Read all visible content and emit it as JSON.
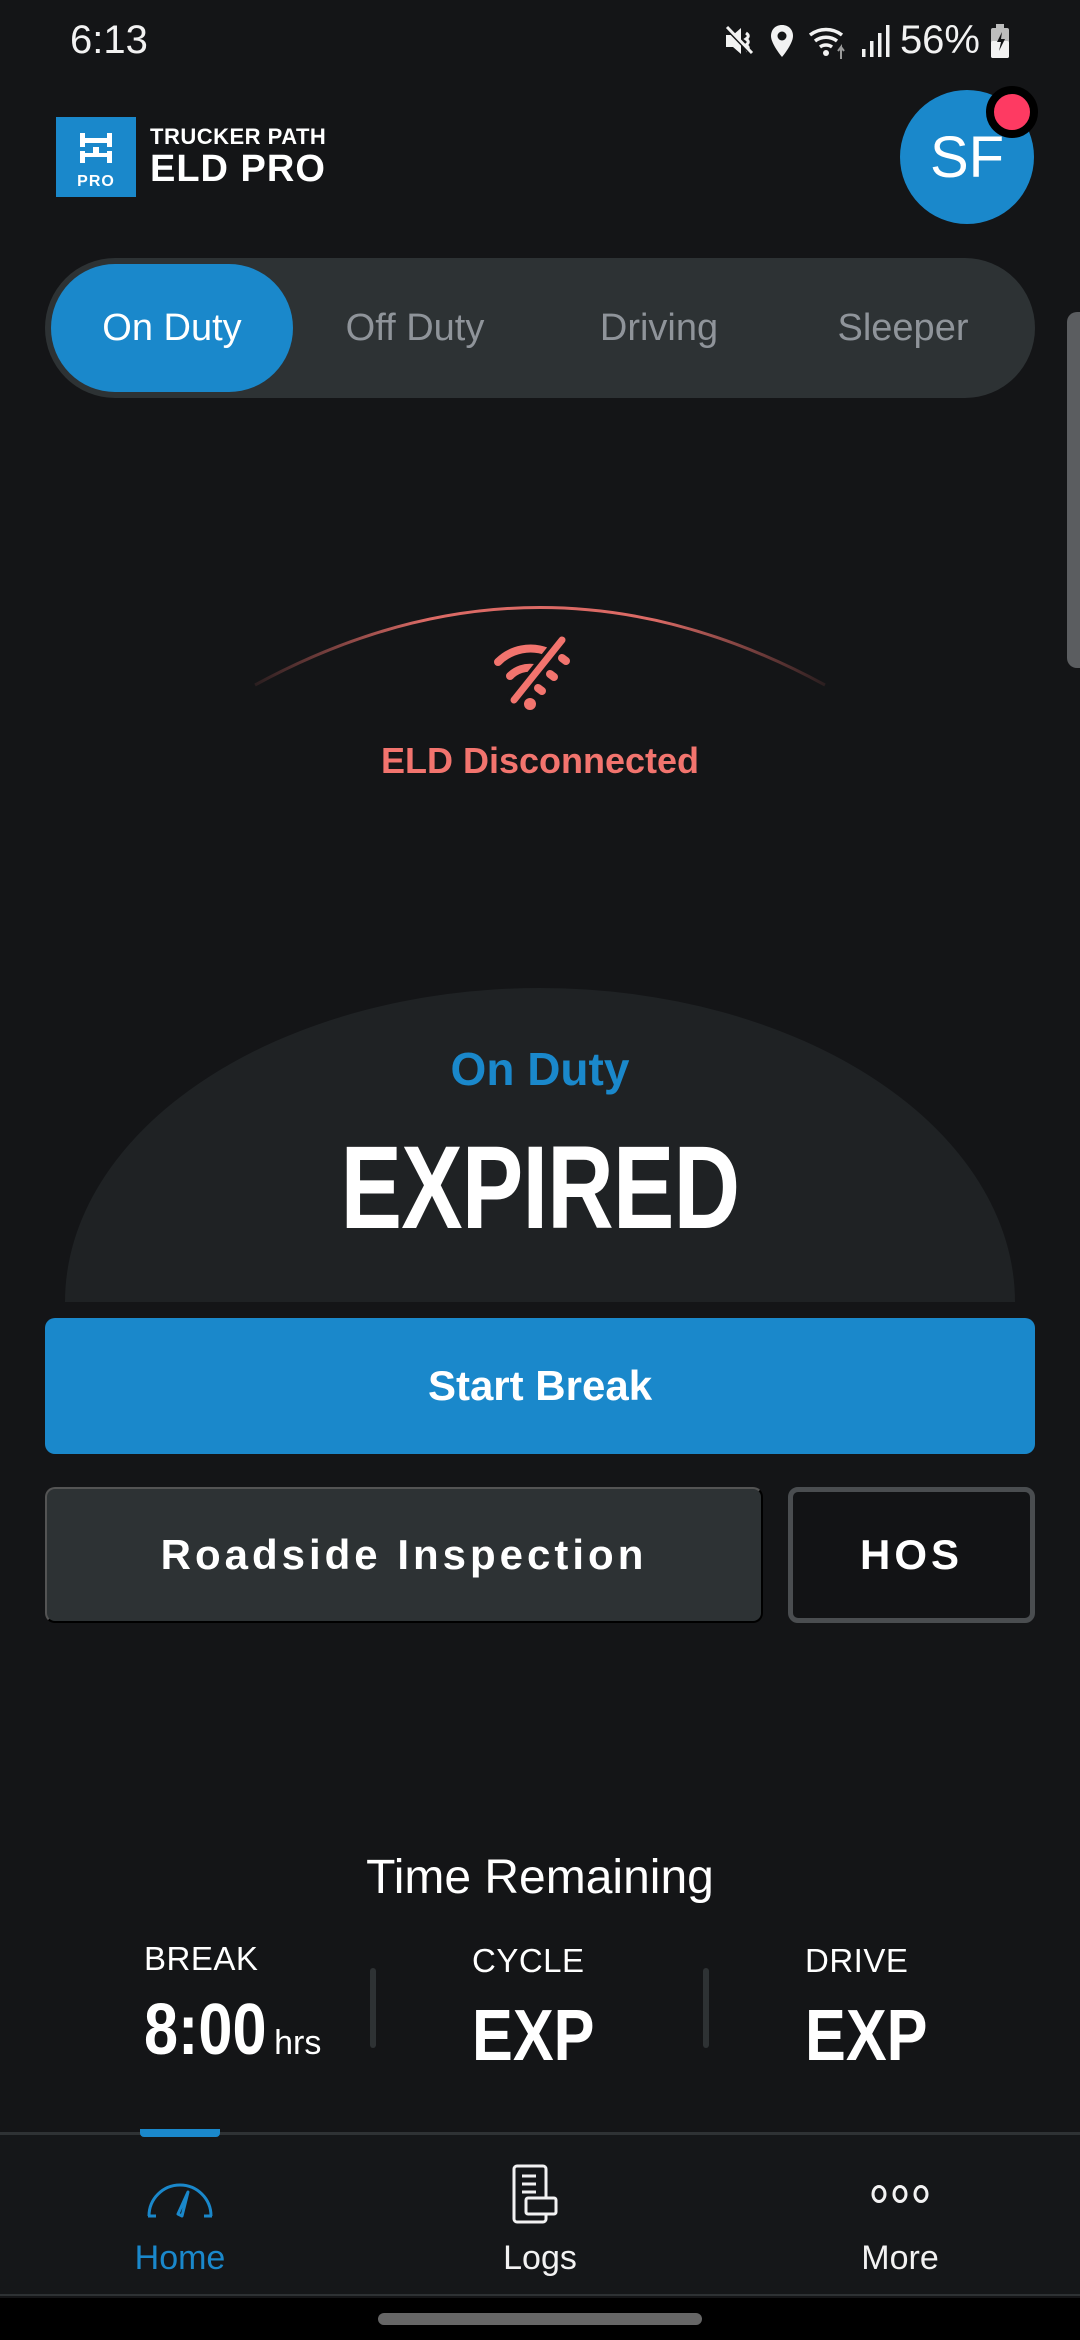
{
  "status_bar": {
    "time": "6:13",
    "battery_percent": "56%",
    "icons": [
      "mute-vibrate-icon",
      "location-icon",
      "wifi-icon",
      "signal-icon",
      "battery-charging-icon"
    ]
  },
  "header": {
    "logo_top": "TRUCKER PATH",
    "logo_bottom": "ELD PRO",
    "logo_badge": "PRO",
    "avatar_initials": "SF",
    "notification_dot_color": "#fe3a62"
  },
  "duty_tabs": {
    "selected": "On Duty",
    "items": [
      {
        "label": "On Duty",
        "active": true
      },
      {
        "label": "Off Duty",
        "active": false
      },
      {
        "label": "Driving",
        "active": false
      },
      {
        "label": "Sleeper",
        "active": false
      }
    ]
  },
  "eld": {
    "status_text": "ELD Disconnected",
    "icon": "wifi-off-icon",
    "color": "#f2746e"
  },
  "status_dome": {
    "label": "On Duty",
    "value": "EXPIRED"
  },
  "actions": {
    "start_break": "Start Break",
    "roadside_inspection": "Roadside Inspection",
    "hos": "HOS"
  },
  "time_remaining": {
    "title": "Time Remaining",
    "items": [
      {
        "label": "BREAK",
        "value": "8:00",
        "unit": "hrs"
      },
      {
        "label": "CYCLE",
        "value": "EXP",
        "unit": ""
      },
      {
        "label": "DRIVE",
        "value": "EXP",
        "unit": ""
      }
    ]
  },
  "bottom_nav": {
    "items": [
      {
        "label": "Home",
        "icon": "speedometer-icon",
        "active": true
      },
      {
        "label": "Logs",
        "icon": "logs-document-icon",
        "active": false
      },
      {
        "label": "More",
        "icon": "more-dots-icon",
        "active": false
      }
    ]
  },
  "colors": {
    "accent": "#1a88cb",
    "background": "#141517",
    "surface": "#2d3234",
    "error": "#f2746e"
  }
}
